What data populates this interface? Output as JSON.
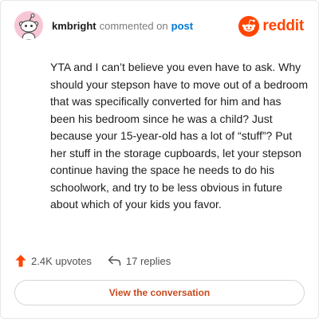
{
  "header": {
    "username": "kmbright",
    "action_text": "commented on",
    "link_text": "post"
  },
  "brand": {
    "name": "reddit",
    "color": "#ff4500",
    "icon": "reddit-snoo-icon"
  },
  "comment": {
    "body": "YTA and I can’t believe you even have to ask. Why should your stepson have to move out of a bedroom that was specifically converted for him and has been his bedroom since he was a child? Just because your 15-year-old has a lot of “stuff”? Put her stuff in the storage cupboards, let your stepson continue having the space he needs to do his schoolwork, and try to be less obvious in future about which of your kids you favor."
  },
  "stats": {
    "upvotes": "2.4K upvotes",
    "replies": "17 replies",
    "upvote_icon": "upvote-arrow-icon",
    "reply_icon": "reply-arrow-icon",
    "upvote_color": "#ff4500"
  },
  "cta": {
    "label": "View the conversation"
  },
  "avatar": {
    "icon": "snoo-avatar-icon",
    "bg_color": "#f7c6d4"
  }
}
